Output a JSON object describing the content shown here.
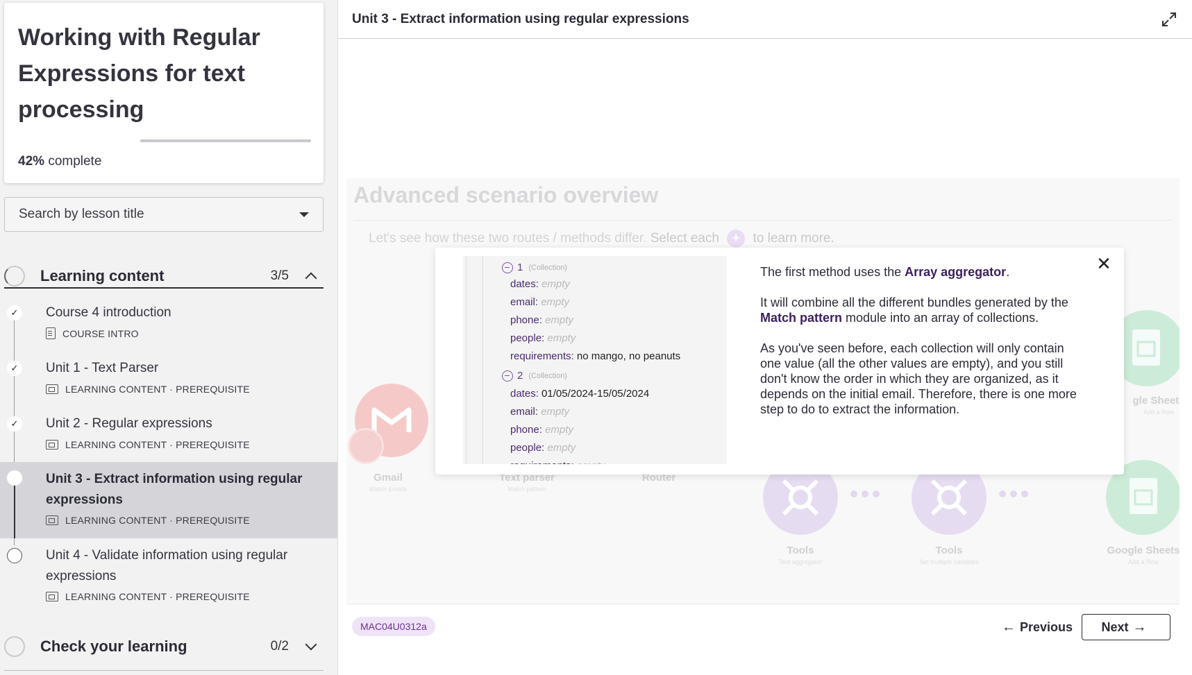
{
  "course": {
    "title": "Working with Regular Expressions for text processing",
    "progress_percent": "42%",
    "progress_label": "complete",
    "progress_value": 0.42
  },
  "search": {
    "placeholder": "Search by lesson title"
  },
  "sections": [
    {
      "title": "Learning content",
      "count": "3/5",
      "expanded": true,
      "lessons": [
        {
          "title": "Course 4 introduction",
          "meta": "COURSE INTRO",
          "status": "done"
        },
        {
          "title": "Unit 1 - Text Parser",
          "meta": "LEARNING CONTENT · PREREQUISITE",
          "status": "done"
        },
        {
          "title": "Unit 2 - Regular expressions",
          "meta": "LEARNING CONTENT · PREREQUISITE",
          "status": "done"
        },
        {
          "title": "Unit 3 - Extract information using regular expressions",
          "meta": "LEARNING CONTENT · PREREQUISITE",
          "status": "current"
        },
        {
          "title": "Unit 4 - Validate information using regular expressions",
          "meta": "LEARNING CONTENT · PREREQUISITE",
          "status": "open"
        }
      ]
    },
    {
      "title": "Check your learning",
      "count": "0/2",
      "expanded": false
    }
  ],
  "main": {
    "unit_title": "Unit 3 - Extract information using regular expressions",
    "scenario": {
      "title": "Advanced scenario overview",
      "subtitle_pre": "Let's see how these two routes / methods differ.",
      "subtitle_select": "Select each",
      "subtitle_post": "to learn more.",
      "nodes": {
        "gmail": {
          "label": "Gmail",
          "sub": "Watch Emails"
        },
        "text_parser": {
          "label": "Text parser",
          "sub": "Match pattern"
        },
        "router": {
          "label": "Router"
        },
        "tools1": {
          "label": "Tools",
          "sub": "Text aggregator"
        },
        "tools2": {
          "label": "Tools",
          "sub": "Set multiple variables"
        },
        "sheets_top": {
          "label": "gle Sheets",
          "sub": "Add a Row"
        },
        "sheets_bottom": {
          "label": "Google Sheets",
          "sub": "Add a Row"
        }
      }
    },
    "modal": {
      "collections": [
        {
          "index": "1",
          "tag": "(Collection)",
          "fields": [
            {
              "key": "dates:",
              "value": "empty",
              "empty": true
            },
            {
              "key": "email:",
              "value": "empty",
              "empty": true
            },
            {
              "key": "phone:",
              "value": "empty",
              "empty": true
            },
            {
              "key": "people:",
              "value": "empty",
              "empty": true
            },
            {
              "key": "requirements:",
              "value": "no mango, no peanuts",
              "empty": false
            }
          ]
        },
        {
          "index": "2",
          "tag": "(Collection)",
          "fields": [
            {
              "key": "dates:",
              "value": "01/05/2024-15/05/2024",
              "empty": false
            },
            {
              "key": "email:",
              "value": "empty",
              "empty": true
            },
            {
              "key": "phone:",
              "value": "empty",
              "empty": true
            },
            {
              "key": "people:",
              "value": "empty",
              "empty": true
            },
            {
              "key": "requirements:",
              "value": "empty",
              "empty": true
            }
          ]
        }
      ],
      "p1_pre": "The first method uses the",
      "p1_bold": "Array aggregator",
      "p1_post": ".",
      "p2_pre": "It will combine all the different bundles generated by the",
      "p2_bold": "Match pattern",
      "p2_post": "module into an array of collections.",
      "p3": "As you've seen before, each collection will only contain one value (all the other values are empty), and you still don't know the order in which they are organized, as it depends on the initial email. Therefore, there is one more step to do to extract the information."
    },
    "footer": {
      "badge": "MAC04U0312a",
      "prev_label": "Previous",
      "next_label": "Next"
    }
  },
  "colors": {
    "accent_purple": "#6b2f99",
    "gmail_red": "#f2b8b8",
    "tools_purple": "#e6dcf2",
    "sheets_green": "#cdebd9"
  }
}
